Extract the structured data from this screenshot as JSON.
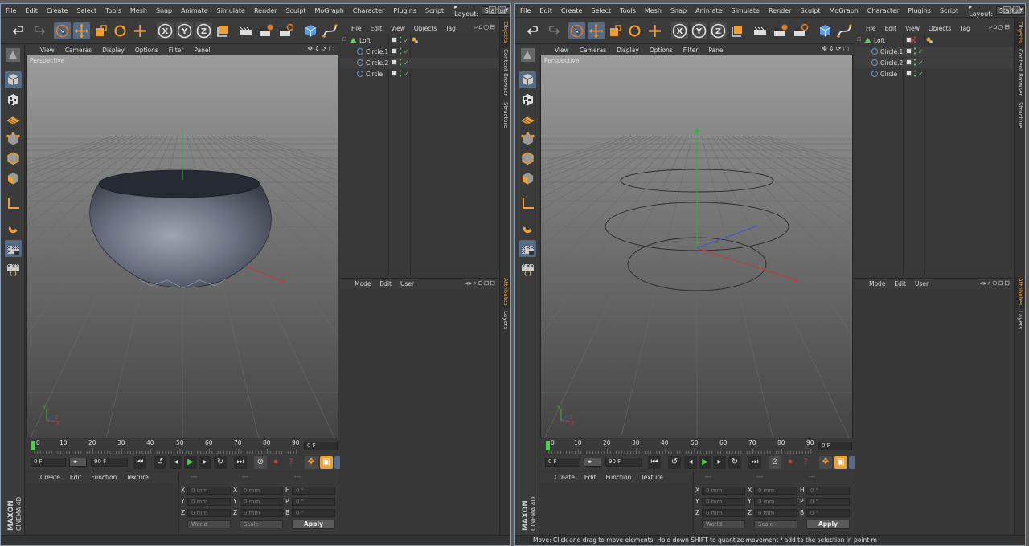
{
  "menu": [
    "File",
    "Edit",
    "Create",
    "Select",
    "Tools",
    "Mesh",
    "Snap",
    "Animate",
    "Simulate",
    "Render",
    "Sculpt",
    "MoGraph",
    "Character",
    "Plugins",
    "Script"
  ],
  "layout": {
    "label": "Layout:",
    "value": "Startup"
  },
  "viewport": {
    "menu": [
      "View",
      "Cameras",
      "Display",
      "Options",
      "Filter",
      "Panel"
    ],
    "label": "Perspective"
  },
  "timeline": {
    "ticks": [
      "0",
      "10",
      "20",
      "30",
      "40",
      "50",
      "60",
      "70",
      "80",
      "90"
    ],
    "current_frame": "0 F",
    "start_frame": "0 F",
    "end_frame": "90 F"
  },
  "material_menu": [
    "Create",
    "Edit",
    "Function",
    "Texture"
  ],
  "coords": {
    "col_headers": [
      "---",
      "---",
      "---"
    ],
    "rows": [
      {
        "a": "X",
        "a_val": "0 mm",
        "b": "X",
        "b_val": "0 mm",
        "c": "H",
        "c_val": "0 °"
      },
      {
        "a": "Y",
        "a_val": "0 mm",
        "b": "Y",
        "b_val": "0 mm",
        "c": "P",
        "c_val": "0 °"
      },
      {
        "a": "Z",
        "a_val": "0 mm",
        "b": "Z",
        "b_val": "0 mm",
        "c": "B",
        "c_val": "0 °"
      }
    ],
    "world": "World",
    "scale": "Scale",
    "apply": "Apply"
  },
  "objects": {
    "menu": [
      "File",
      "Edit",
      "View",
      "Objects",
      "Tag"
    ],
    "items": [
      {
        "name": "Loft",
        "level": 0
      },
      {
        "name": "Circle.1",
        "level": 1
      },
      {
        "name": "Circle.2",
        "level": 1
      },
      {
        "name": "Circle",
        "level": 1
      }
    ]
  },
  "attributes": {
    "menu": [
      "Mode",
      "Edit",
      "User"
    ]
  },
  "tabs_top": [
    "Objects",
    "Content Browser",
    "Structure"
  ],
  "tabs_bottom": [
    "Attributes",
    "Layers"
  ],
  "brand": {
    "line1": "MAXON",
    "line2": "CINEMA 4D"
  },
  "status_right": "Move: Click and drag to move elements. Hold down SHIFT to quantize movement / add to the selection in point m",
  "colors": {
    "accent": "#556a86",
    "highlight": "#e6a43b",
    "active_tab": "#f0a030"
  }
}
